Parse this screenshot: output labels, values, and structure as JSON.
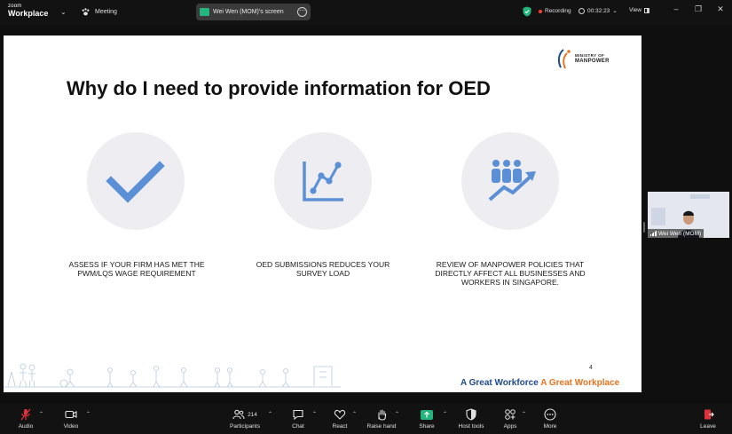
{
  "app": {
    "brand_top": "zoom",
    "brand_bottom": "Workplace",
    "meeting_label": "Meeting",
    "share_label": "Wei Wen (MOM)'s screen",
    "recording_label": "Recording",
    "timer": "00:32:23",
    "view_label": "View"
  },
  "slide": {
    "title": "Why do I need to provide information for OED",
    "logo_line1": "MINISTRY OF",
    "logo_line2": "MANPOWER",
    "items": [
      {
        "icon": "checkmark-icon",
        "caption": "ASSESS IF YOUR FIRM HAS MET THE PWM/LQS WAGE REQUIREMENT"
      },
      {
        "icon": "line-chart-icon",
        "caption": "OED SUBMISSIONS REDUCES YOUR SURVEY LOAD"
      },
      {
        "icon": "people-growth-icon",
        "caption": "REVIEW OF MANPOWER POLICIES THAT DIRECTLY AFFECT ALL BUSINESSES AND WORKERS IN SINGAPORE."
      }
    ],
    "page_number": "4",
    "tagline_part1": "A Great Workforce",
    "tagline_part2": "A Great Workplace",
    "icon_color": "#5b8fd6",
    "circle_color": "#eeedf1"
  },
  "thumbnail": {
    "name": "Wei Wen (MOM)"
  },
  "toolbar": {
    "audio": "Audio",
    "video": "Video",
    "participants": "Participants",
    "participants_count": "214",
    "chat": "Chat",
    "react": "React",
    "raise_hand": "Raise hand",
    "share": "Share",
    "host_tools": "Host tools",
    "apps": "Apps",
    "more": "More",
    "leave": "Leave"
  },
  "colors": {
    "accent_green": "#24b47e",
    "record_red": "#ff3b30",
    "leave_red": "#e0313b"
  }
}
